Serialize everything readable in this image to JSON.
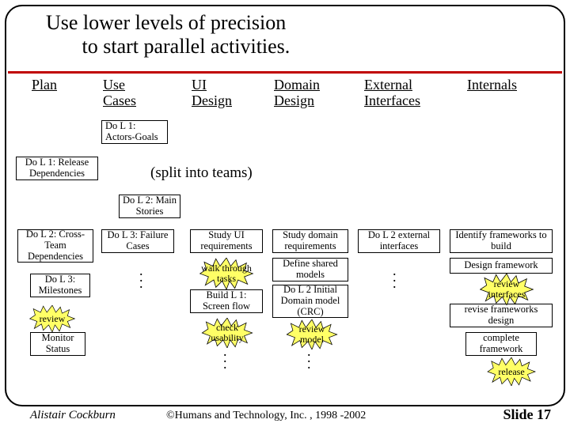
{
  "title": "Use lower levels of precision\n       to start parallel activities.",
  "headers": {
    "plan": "Plan",
    "usecases": "Use\nCases",
    "ui": "UI\nDesign",
    "domain": "Domain\nDesign",
    "external": "External\nInterfaces",
    "internals": "Internals"
  },
  "split_label": "(split into teams)",
  "boxes": {
    "actors_goals": "Do L 1:\nActors-Goals",
    "release_deps": "Do L 1: Release\nDependencies",
    "main_stories": "Do L 2:\nMain Stories",
    "cross_team": "Do L 2:\nCross-Team\nDependencies",
    "failure_cases": "Do L 3:\nFailure Cases",
    "study_ui": "Study UI\nrequirements",
    "study_domain": "Study domain\nrequirements",
    "l2_ext": "Do L 2 external\ninterfaces",
    "identify_fw": "Identify frameworks\nto build",
    "milestones": "Do L 3:\nMilestones",
    "define_shared": "Define shared\nmodels",
    "design_fw": "Design framework",
    "build_screenflow": "Build L 1:\nScreen flow",
    "domain_crc": "Do L 2 Initial\nDomain model\n(CRC)",
    "revise_fw": "revise frameworks\ndesign",
    "monitor_status": "Monitor\nStatus",
    "complete_fw": "complete\nframework"
  },
  "bursts": {
    "walk_tasks": "walk through\ntasks",
    "review": "review",
    "check_usability": "check\nusability",
    "review_model": "review\nmodel",
    "review_interfaces": "review\ninterfaces",
    "release": "release"
  },
  "footer": {
    "author": "Alistair Cockburn",
    "copyright": "©Humans and Technology, Inc. , 1998 -2002",
    "slide": "Slide 17"
  }
}
